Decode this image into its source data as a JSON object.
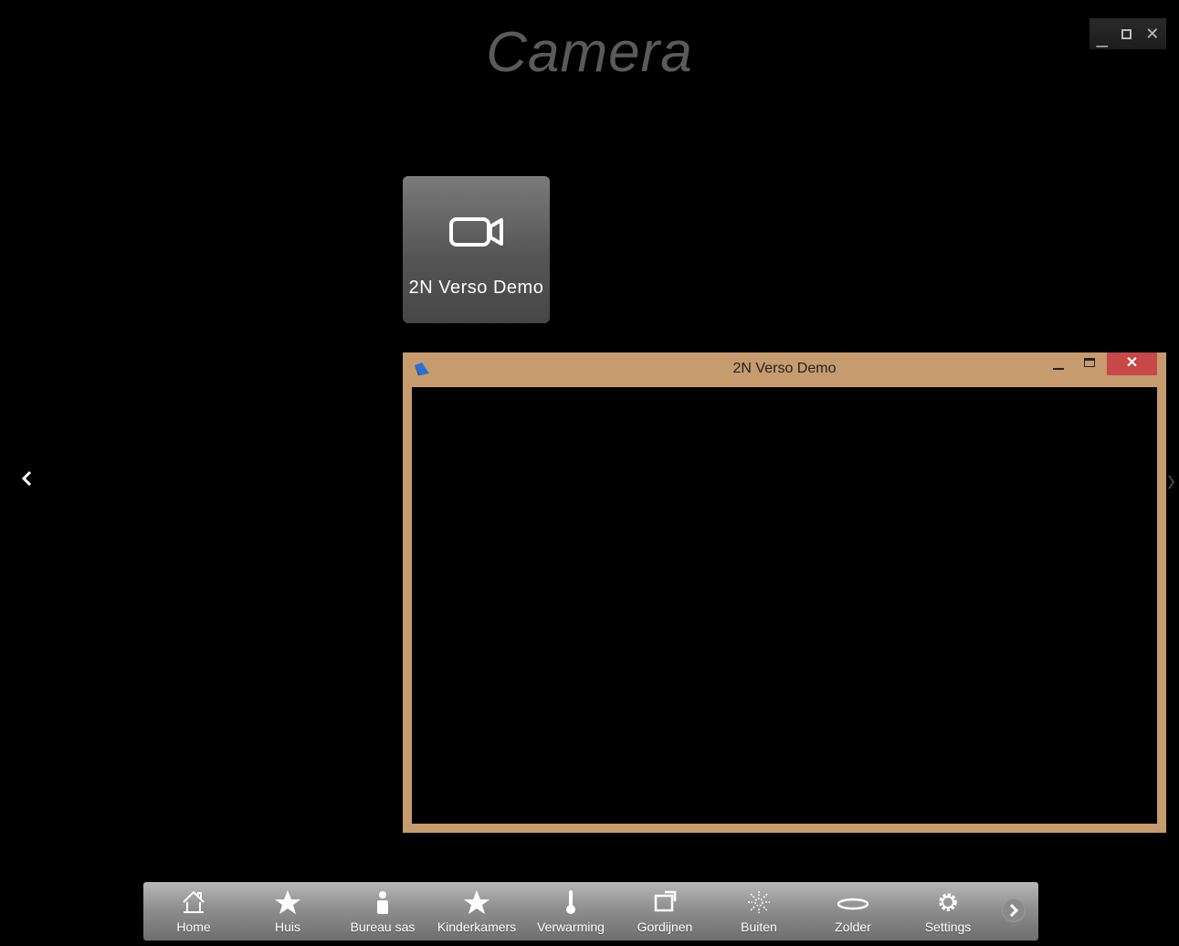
{
  "app": {
    "title": "Camera",
    "window_controls": {
      "minimize": "_",
      "close": "✕"
    }
  },
  "tiles": [
    {
      "label": "2N Verso Demo",
      "icon": "video-camera-icon"
    }
  ],
  "nav": {
    "prev": "chevron-left-icon",
    "next": "chevron-right-icon"
  },
  "popup": {
    "title": "2N Verso Demo",
    "close": "✕",
    "colors": {
      "frame": "#c69b6d",
      "close_bg": "#c74848"
    }
  },
  "taskbar": {
    "items": [
      {
        "label": "Home",
        "icon": "home-icon"
      },
      {
        "label": "Huis",
        "icon": "star-icon"
      },
      {
        "label": "Bureau sas",
        "icon": "person-icon"
      },
      {
        "label": "Kinderkamers",
        "icon": "star-icon"
      },
      {
        "label": "Verwarming",
        "icon": "thermometer-icon"
      },
      {
        "label": "Gordijnen",
        "icon": "window-icon"
      },
      {
        "label": "Buiten",
        "icon": "sun-icon"
      },
      {
        "label": "Zolder",
        "icon": "ellipse-icon"
      },
      {
        "label": "Settings",
        "icon": "gear-icon"
      }
    ],
    "next": "chevron-right-icon"
  }
}
